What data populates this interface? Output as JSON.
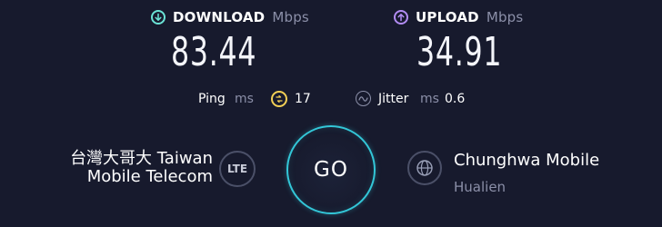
{
  "colors": {
    "background": "#171a2d",
    "download_accent": "#6be3d6",
    "upload_accent": "#b28cf3",
    "ping_accent": "#f2cf55",
    "go_ring": "#33c7d8",
    "muted_text": "#8b8fa8"
  },
  "download": {
    "icon": "arrow-down-circle-icon",
    "label": "DOWNLOAD",
    "unit": "Mbps",
    "value": "83.44"
  },
  "upload": {
    "icon": "arrow-up-circle-icon",
    "label": "UPLOAD",
    "unit": "Mbps",
    "value": "34.91"
  },
  "ping": {
    "label": "Ping",
    "unit": "ms",
    "icon": "ping-idle-icon",
    "value": "17"
  },
  "jitter": {
    "icon": "jitter-wave-icon",
    "label": "Jitter",
    "unit": "ms",
    "value": "0.6"
  },
  "isp": {
    "line1": "台灣大哥大 Taiwan",
    "line2": "Mobile Telecom",
    "connection_badge": "LTE"
  },
  "go_button": {
    "label": "GO"
  },
  "server": {
    "icon": "globe-icon",
    "name": "Chunghwa Mobile",
    "location": "Hualien"
  }
}
